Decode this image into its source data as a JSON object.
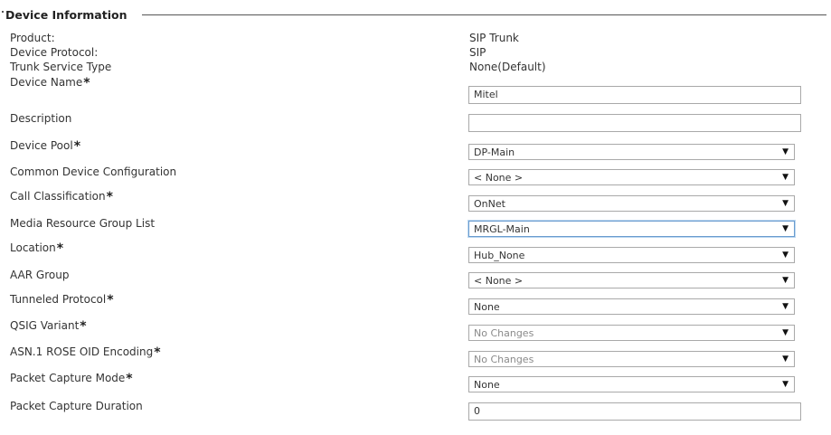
{
  "section": {
    "title": "Device Information"
  },
  "info_rows": [
    {
      "label": "Product:",
      "value": "SIP Trunk"
    },
    {
      "label": "Device Protocol:",
      "value": "SIP"
    },
    {
      "label": "Trunk Service Type",
      "value": "None(Default)"
    }
  ],
  "fields": {
    "device_name": {
      "label": "Device Name",
      "required": "*",
      "value": "Mitel"
    },
    "description": {
      "label": "Description",
      "value": ""
    },
    "device_pool": {
      "label": "Device Pool",
      "required": "*",
      "value": "DP-Main"
    },
    "common_device_configuration": {
      "label": "Common Device Configuration",
      "value": "< None >"
    },
    "call_classification": {
      "label": "Call Classification",
      "required": "*",
      "value": "OnNet"
    },
    "media_resource_group_list": {
      "label": "Media Resource Group List",
      "value": "MRGL-Main"
    },
    "location": {
      "label": "Location",
      "required": "*",
      "value": "Hub_None"
    },
    "aar_group": {
      "label": "AAR Group",
      "value": "< None >"
    },
    "tunneled_protocol": {
      "label": "Tunneled Protocol",
      "required": "*",
      "value": "None"
    },
    "qsig_variant": {
      "label": "QSIG Variant",
      "required": "*",
      "value": "No Changes"
    },
    "asn1_rose_oid_encoding": {
      "label": "ASN.1 ROSE OID Encoding",
      "required": "*",
      "value": "No Changes"
    },
    "packet_capture_mode": {
      "label": "Packet Capture Mode",
      "required": "*",
      "value": "None"
    },
    "packet_capture_duration": {
      "label": "Packet Capture Duration",
      "value": "0"
    }
  },
  "icons": {
    "dropdown_caret": "▼"
  }
}
